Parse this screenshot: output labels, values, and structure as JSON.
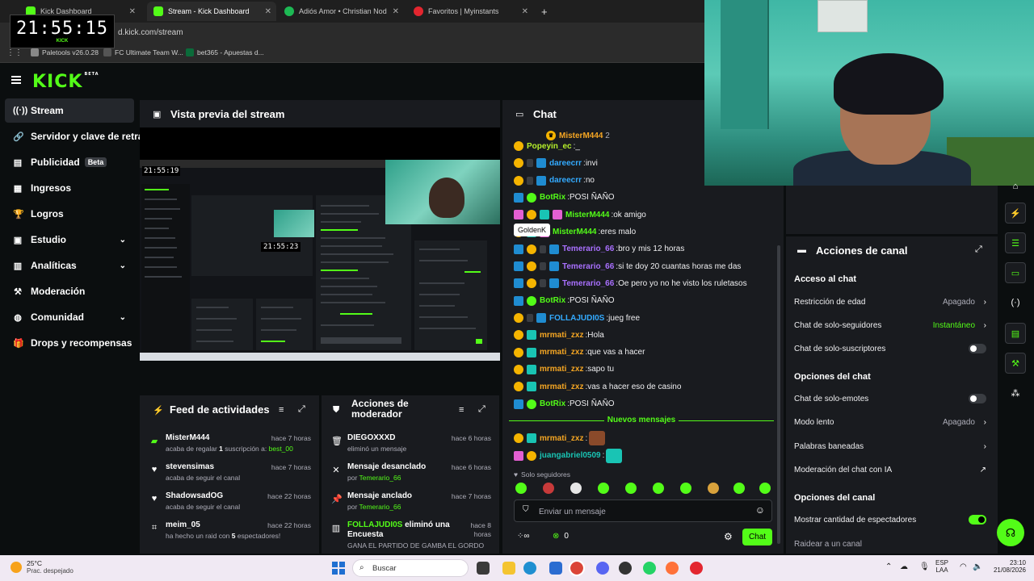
{
  "browser": {
    "tabs": [
      {
        "label": "Kick Dashboard",
        "partial": "KICK"
      },
      {
        "label": "Stream - Kick Dashboard"
      },
      {
        "label": "Adiós Amor • Christian Nod"
      },
      {
        "label": "Favoritos | Myinstants"
      }
    ],
    "url": "d.kick.com/stream",
    "bookmarks": [
      "Paletools v26.0.28",
      "FC Ultimate Team W...",
      "bet365 - Apuestas d..."
    ],
    "clock": "21:55:15",
    "clock_brand": "KICK"
  },
  "app": {
    "logo": "KICK",
    "logo_tag": "BETA"
  },
  "sidebar": {
    "items": [
      {
        "label": "Stream",
        "icon": "broadcast-icon",
        "glyph": "((·))",
        "active": true
      },
      {
        "label": "Servidor y clave de retransmisión",
        "icon": "link-icon",
        "glyph": "🔗"
      },
      {
        "label": "Publicidad",
        "icon": "ad-icon",
        "glyph": "▤",
        "badge": "Beta"
      },
      {
        "label": "Ingresos",
        "icon": "revenue-icon",
        "glyph": "▦"
      },
      {
        "label": "Logros",
        "icon": "trophy-icon",
        "glyph": "🏆"
      },
      {
        "label": "Estudio",
        "icon": "studio-icon",
        "glyph": "▣",
        "chevron": true
      },
      {
        "label": "Analíticas",
        "icon": "analytics-icon",
        "glyph": "▥",
        "chevron": true
      },
      {
        "label": "Moderación",
        "icon": "hammer-icon",
        "glyph": "⚒"
      },
      {
        "label": "Comunidad",
        "icon": "community-icon",
        "glyph": "◍",
        "chevron": true
      },
      {
        "label": "Drops y recompensas",
        "icon": "gift-icon",
        "glyph": "🎁"
      }
    ]
  },
  "preview": {
    "title": "Vista previa del stream",
    "mini_clock": "21:55:19",
    "mini_clock2": "21:55:23"
  },
  "feed": {
    "title": "Feed de actividades",
    "items": [
      {
        "name": "MisterM444",
        "time": "hace 7 horas",
        "desc_pre": "acaba de regalar ",
        "desc_bold": "1",
        "desc_mid": " suscripción a: ",
        "desc_green": "best_00",
        "icon": "gift-icon",
        "glyph": "▰"
      },
      {
        "name": "stevensimas",
        "time": "hace 7 horas",
        "desc_pre": "acaba de seguir el canal",
        "icon": "heart-icon",
        "glyph": "♥"
      },
      {
        "name": "ShadowsadOG",
        "time": "hace 22 horas",
        "desc_pre": "acaba de seguir el canal",
        "icon": "heart-icon",
        "glyph": "♥"
      },
      {
        "name": "meim_05",
        "time": "hace 22 horas",
        "desc_pre": "ha hecho un raid con ",
        "desc_bold": "5",
        "desc_mid": " espectadores!",
        "icon": "raid-icon",
        "glyph": "⌗"
      }
    ]
  },
  "mod": {
    "title_line1": "Acciones de",
    "title_line2": "moderador",
    "items": [
      {
        "name": "DIEGOXXXD",
        "time": "hace 6 horas",
        "desc": "eliminó un mensaje",
        "icon": "trash-icon",
        "glyph": "🗑"
      },
      {
        "name": "Mensaje desanclado",
        "time": "hace 6 horas",
        "desc_pre": "por ",
        "desc_green": "Temerario_66",
        "icon": "unpin-icon",
        "glyph": "✕"
      },
      {
        "name": "Mensaje anclado",
        "time": "hace 7 horas",
        "desc_pre": "por ",
        "desc_green": "Temerario_66",
        "icon": "pin-icon",
        "glyph": "📌"
      },
      {
        "name_green": "FOLLAJUDI0S",
        "name_rest": " eliminó una",
        "name_line2": "Encuesta",
        "time": "hace 8",
        "time2": "horas",
        "desc": "GANA EL PARTIDO DE GAMBA EL GORDO",
        "icon": "poll-icon",
        "glyph": "▥"
      }
    ]
  },
  "chat": {
    "title": "Chat",
    "pinned_user": "MisterM444",
    "pinned_count": "2",
    "tooltip": "GoldenK",
    "new_messages": "Nuevos mensajes",
    "messages": [
      {
        "user": "Popeyin_ec",
        "text": " _",
        "color": "u-lime",
        "badges": [
          "b-gold"
        ]
      },
      {
        "user": "dareecrr",
        "text": " invi",
        "color": "u-blue",
        "badges": [
          "b-gold",
          "b-dark",
          "b-blue"
        ]
      },
      {
        "user": "dareecrr",
        "text": " no",
        "color": "u-blue",
        "badges": [
          "b-gold",
          "b-dark",
          "b-blue"
        ]
      },
      {
        "user": "BotRix",
        "text": " POSI ÑAÑO",
        "color": "u-green",
        "badges": [
          "b-blue",
          "b-green"
        ]
      },
      {
        "user": "MisterM444",
        "text": " ok amigo",
        "color": "u-green",
        "badges": [
          "b-pink",
          "b-gold",
          "b-teal",
          "b-pink"
        ]
      },
      {
        "user": "MisterM444",
        "text": " eres malo",
        "color": "u-green",
        "badges": [
          "b-gold",
          "b-teal",
          "b-pink"
        ]
      },
      {
        "user": "Temerario_66",
        "text": " bro y mis 12 horas",
        "color": "u-purple",
        "badges": [
          "b-blue",
          "b-gold",
          "b-dark",
          "b-blue"
        ]
      },
      {
        "user": "Temerario_66",
        "text": " si te doy 20 cuantas horas me das",
        "color": "u-purple",
        "badges": [
          "b-blue",
          "b-gold",
          "b-dark",
          "b-blue"
        ]
      },
      {
        "user": "Temerario_66",
        "text": " Oe pero yo no he visto los ruletasos",
        "color": "u-purple",
        "badges": [
          "b-blue",
          "b-gold",
          "b-dark",
          "b-blue"
        ]
      },
      {
        "user": "BotRix",
        "text": " POSI ÑAÑO",
        "color": "u-green",
        "badges": [
          "b-blue",
          "b-green"
        ]
      },
      {
        "user": "FOLLAJUDI0S",
        "text": " jueg free",
        "color": "u-blue",
        "badges": [
          "b-gold",
          "b-dark",
          "b-blue"
        ]
      },
      {
        "user": "mrmati_zxz",
        "text": " Hola",
        "color": "u-orange",
        "badges": [
          "b-gold",
          "b-teal"
        ]
      },
      {
        "user": "mrmati_zxz",
        "text": " que vas a hacer",
        "color": "u-orange",
        "badges": [
          "b-gold",
          "b-teal"
        ]
      },
      {
        "user": "mrmati_zxz",
        "text": " sapo tu",
        "color": "u-orange",
        "badges": [
          "b-gold",
          "b-teal"
        ]
      },
      {
        "user": "mrmati_zxz",
        "text": " vas a hacer eso de casino",
        "color": "u-orange",
        "badges": [
          "b-gold",
          "b-teal"
        ]
      },
      {
        "user": "BotRix",
        "text": " POSI ÑAÑO",
        "color": "u-green",
        "badges": [
          "b-blue",
          "b-green"
        ]
      }
    ],
    "new": [
      {
        "user": "mrmati_zxz",
        "text": " ",
        "color": "u-orange",
        "badges": [
          "b-gold",
          "b-teal"
        ]
      },
      {
        "user": "juangabriel0509",
        "text": " ",
        "color": "u-teal",
        "badges": [
          "b-pink",
          "b-gold"
        ]
      }
    ],
    "followers_only": "Solo seguidores",
    "input_placeholder": "Enviar un mensaje",
    "viewer_count": "0",
    "send_label": "Chat"
  },
  "channel": {
    "title": "Acciones de canal",
    "sections": {
      "access": "Acceso al chat",
      "options": "Opciones del chat",
      "channel": "Opciones del canal"
    },
    "rows": {
      "age": {
        "label": "Restricción de edad",
        "value": "Apagado"
      },
      "followers": {
        "label": "Chat de solo-seguidores",
        "value": "Instantáneo"
      },
      "subs": {
        "label": "Chat de solo-suscriptores"
      },
      "emotes": {
        "label": "Chat de solo-emotes"
      },
      "slow": {
        "label": "Modo lento",
        "value": "Apagado"
      },
      "banned": {
        "label": "Palabras baneadas"
      },
      "ai": {
        "label": "Moderación del chat con IA"
      },
      "viewers": {
        "label": "Mostrar cantidad de espectadores"
      },
      "raid": {
        "label": "Raidear a un canal"
      }
    }
  },
  "taskbar": {
    "temp": "25°C",
    "weather": "Prac. despejado",
    "search": "Buscar",
    "lang1": "ESP",
    "lang2": "LAA",
    "time": "23:10",
    "date": "21/08/2026"
  }
}
